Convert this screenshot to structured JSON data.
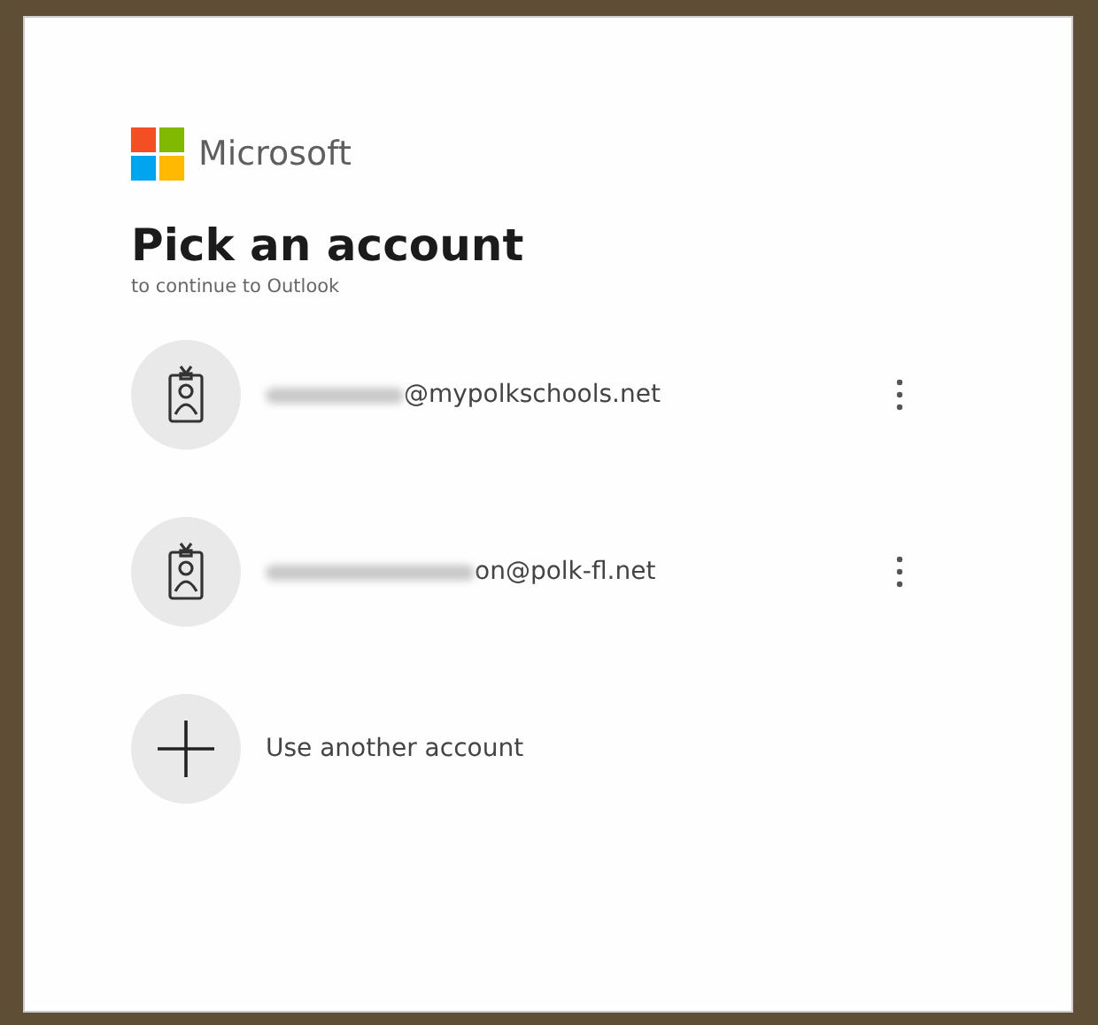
{
  "brand": {
    "name": "Microsoft"
  },
  "title": "Pick an account",
  "subtitle": "to continue to Outlook",
  "accounts": [
    {
      "kind": "account",
      "email": "@mypolkschools.net"
    },
    {
      "kind": "account",
      "email": "on@polk-fl.net"
    },
    {
      "kind": "add",
      "email": "Use another account"
    }
  ]
}
